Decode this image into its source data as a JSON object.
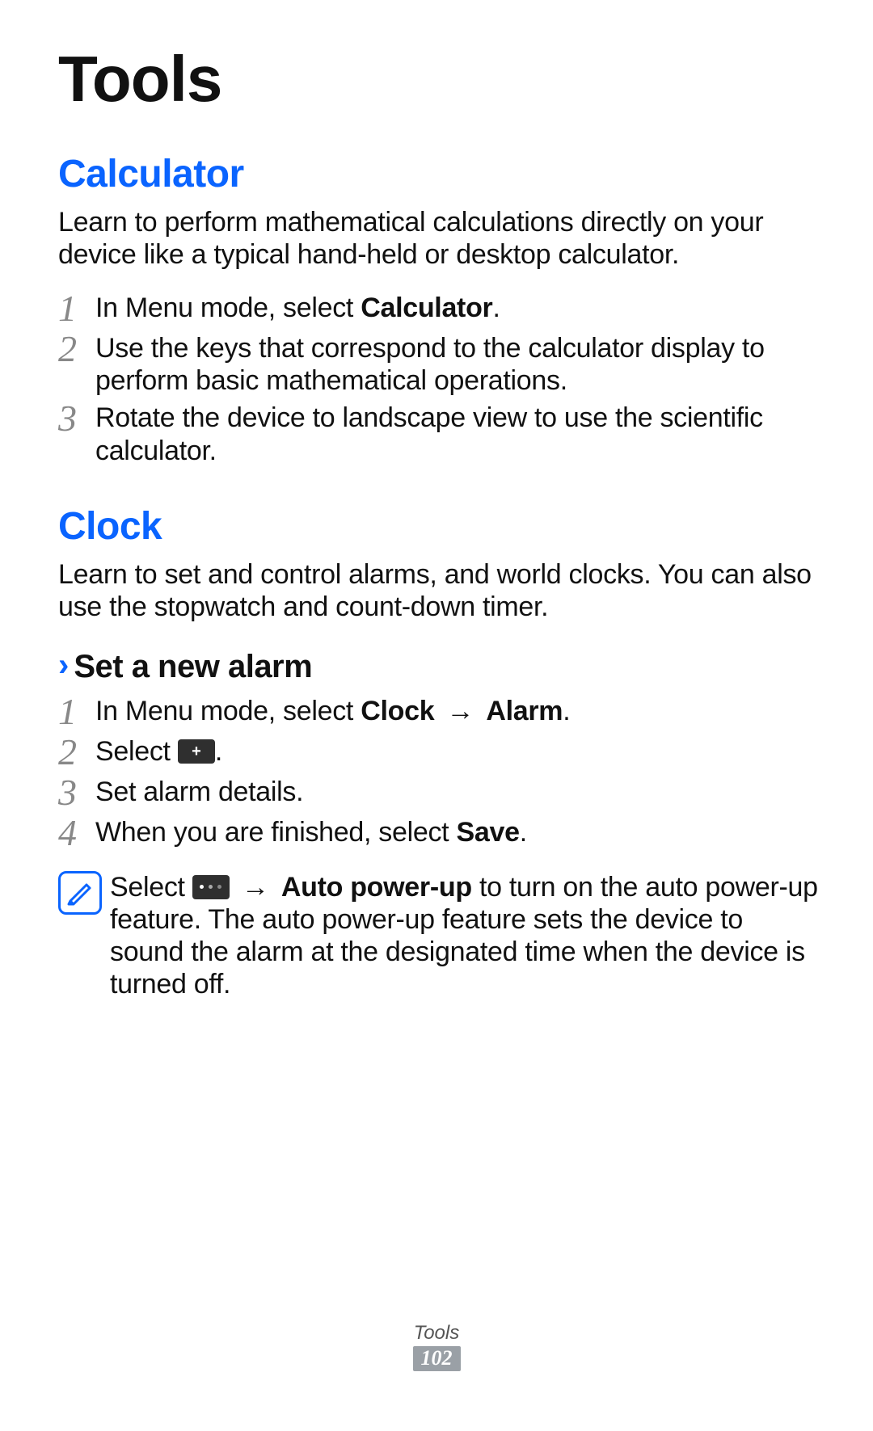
{
  "title": "Tools",
  "section_calculator": {
    "heading": "Calculator",
    "intro": "Learn to perform mathematical calculations directly on your device like a typical hand-held or desktop calculator.",
    "steps": [
      {
        "num": "1",
        "pre": "In Menu mode, select ",
        "bold": "Calculator",
        "post": "."
      },
      {
        "num": "2",
        "text": "Use the keys that correspond to the calculator display to perform basic mathematical operations."
      },
      {
        "num": "3",
        "text": "Rotate the device to landscape view to use the scientific calculator."
      }
    ]
  },
  "section_clock": {
    "heading": "Clock",
    "intro": "Learn to set and control alarms, and world clocks. You can also use the stopwatch and count-down timer.",
    "subheading": "Set a new alarm",
    "steps": [
      {
        "num": "1",
        "pre": "In Menu mode, select ",
        "bold1": "Clock",
        "arrow": " → ",
        "bold2": "Alarm",
        "post": "."
      },
      {
        "num": "2",
        "pre": "Select ",
        "icon": "plus",
        "post": "."
      },
      {
        "num": "3",
        "text": "Set alarm details."
      },
      {
        "num": "4",
        "pre": "When you are finished, select ",
        "bold": "Save",
        "post": "."
      }
    ],
    "note": {
      "pre": "Select ",
      "arrow": " → ",
      "bold": "Auto power-up",
      "post": " to turn on the auto power-up feature. The auto power-up feature sets the device to sound the alarm at the designated time when the device is turned off."
    }
  },
  "footer": {
    "chapter": "Tools",
    "page": "102"
  }
}
